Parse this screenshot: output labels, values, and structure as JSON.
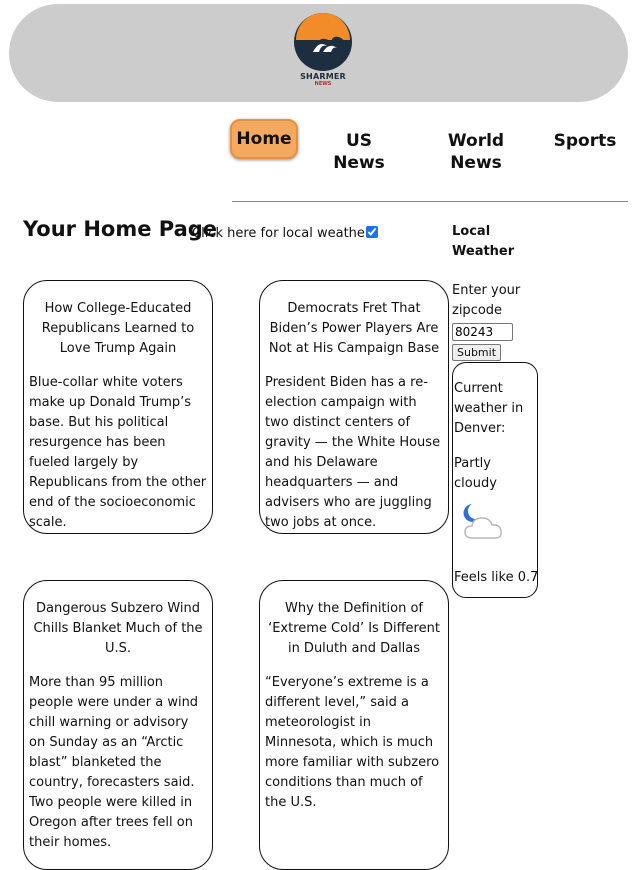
{
  "header": {
    "logo_name": "SHARMER",
    "logo_sub": "NEWS"
  },
  "nav": {
    "home": "Home",
    "us_news": "US News",
    "world_news": "World News",
    "sports": "Sports"
  },
  "page": {
    "title": "Your Home Page",
    "weather_toggle_label": "Click here for local weather",
    "weather_toggle_checked": true
  },
  "articles": [
    {
      "title": "How College-Educated Republicans Learned to Love Trump Again",
      "body": "Blue-collar white voters make up Donald Trump’s base. But his political resurgence has been fueled largely by Republicans from the other end of the socioeconomic scale."
    },
    {
      "title": "Democrats Fret That Biden’s Power Players Are Not at His Campaign Base",
      "body": "President Biden has a re-election campaign with two distinct centers of gravity — the White House and his Delaware headquarters — and advisers who are juggling two jobs at once."
    },
    {
      "title": "Dangerous Subzero Wind Chills Blanket Much of the U.S.",
      "body": "More than 95 million people were under a wind chill warning or advisory on Sunday as an “Arctic blast” blanketed the country, forecasters said. Two people were killed in Oregon after trees fell on their homes."
    },
    {
      "title": "Why the Definition of ‘Extreme Cold’ Is Different in Duluth and Dallas",
      "body": "“Everyone’s extreme is a different level,” said a meteorologist in Minnesota, which is much more familiar with subzero conditions than much of the U.S."
    }
  ],
  "weather": {
    "heading": "Local Weather",
    "zip_label": "Enter your zipcode",
    "zip_value": "80243",
    "submit_label": "Submit",
    "current_label": "Current weather in Denver:",
    "condition": "Partly cloudy",
    "condition_icon": "partly-cloudy-night-icon",
    "feels_like": "Feels like 0.7"
  },
  "colors": {
    "header_bg": "#cccccc",
    "nav_active_bg": "#f5a95e",
    "logo_orange": "#f28c28",
    "logo_navy": "#1c2e3f",
    "moon_blue": "#2f6fd6"
  }
}
